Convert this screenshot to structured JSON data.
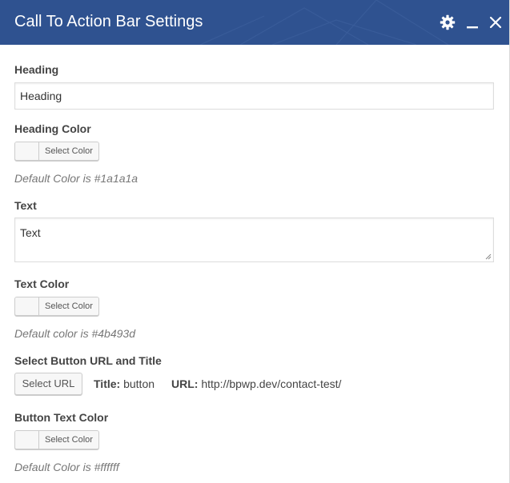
{
  "window": {
    "title": "Call To Action Bar Settings",
    "controls": [
      "gear-icon",
      "minimize-icon",
      "close-icon"
    ],
    "header_color": "#2f5290"
  },
  "fields": {
    "heading": {
      "label": "Heading",
      "value": "Heading"
    },
    "heading_color": {
      "label": "Heading Color",
      "button_label": "Select Color",
      "hint": "Default Color is #1a1a1a"
    },
    "text": {
      "label": "Text",
      "value": "Text"
    },
    "text_color": {
      "label": "Text Color",
      "button_label": "Select Color",
      "hint": "Default color is #4b493d"
    },
    "button_url": {
      "label": "Select Button URL and Title",
      "button_label": "Select URL",
      "title_key": "Title:",
      "title_value": "button",
      "url_key": "URL:",
      "url_value": "http://bpwp.dev/contact-test/"
    },
    "button_text_color": {
      "label": "Button Text Color",
      "button_label": "Select Color",
      "hint": "Default Color is #ffffff"
    }
  }
}
